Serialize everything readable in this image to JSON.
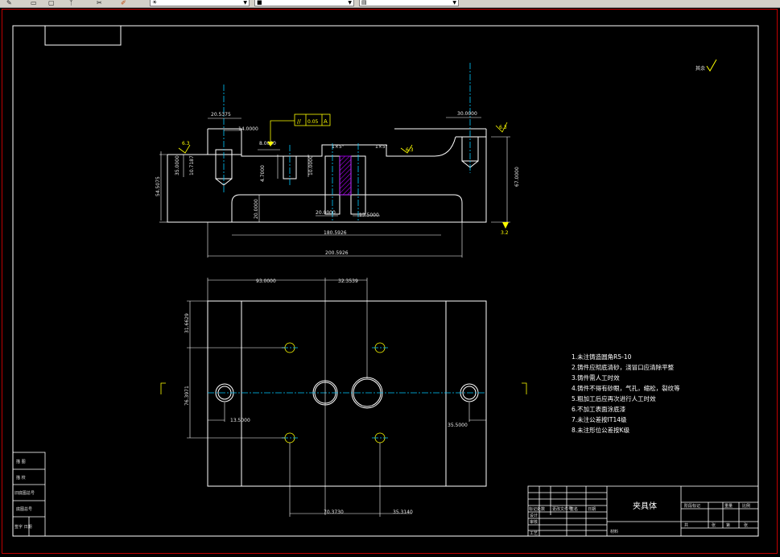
{
  "app": {
    "toolbar": {
      "combo_layer": "",
      "combo_color": "",
      "combo_linetype": ""
    }
  },
  "colors": {
    "background": "#000000",
    "line": "#ffffff",
    "centerline": "#00c8ff",
    "dimension": "#ffffff",
    "hatch": "#b000ff",
    "datum": "#ffff00",
    "frame": "#c00000"
  },
  "drawing": {
    "roughness_note": "其余",
    "top_view": {
      "dims": {
        "d1": "20.5375",
        "d2": "14.0000",
        "d3": "30.0000",
        "d4": "8.0000",
        "d5": "20.0000",
        "d6": "13.5000",
        "d7": "180.5926",
        "d8": "200.5926",
        "d9": "54.5075",
        "d10": "35.0000",
        "d11": "10.7187",
        "d12": "67.0000",
        "d13": "20.0000",
        "d14": "4.7000",
        "d15": "10.0000"
      },
      "tolerance_symbol": "//",
      "tolerance_value": "0.05",
      "datum_a": "A",
      "datum_b": "B",
      "section_labels": [
        "1×5°",
        "1×5°"
      ],
      "roughness_labels": [
        "6.3",
        "6.3",
        "6.3",
        "3.2"
      ]
    },
    "front_view": {
      "dims": {
        "d1": "93.0000",
        "d2": "32.3539",
        "d3": "31.6629",
        "d4": "76.3971",
        "d5": "13.5000",
        "d6": "35.5000",
        "d7": "70.3730",
        "d8": "35.3140"
      },
      "section_mark": "L"
    },
    "notes": [
      "1.未注铸造圆角R5-10",
      "2.铸件应彻底清砂，浇冒口应清除平整",
      "3.铸件需人工时效",
      "4.铸件不得有砂眼，气孔，缩松，裂纹等",
      "5.粗加工后应再次进行人工时效",
      "6.不加工表面涂底漆",
      "7.未注公差按IT14级",
      "8.未注形位公差按K级"
    ]
  },
  "title_block": {
    "part_name": "夹具体",
    "material_label": "材料",
    "side_rows": [
      "描 图",
      "描 校",
      "旧底图总号",
      "底图总号",
      "签字 日期"
    ],
    "rows": [
      "标记处数",
      "更改文件号",
      "签名",
      "日期",
      "设计",
      "审核",
      "工艺"
    ],
    "right_header": [
      "阶段标记",
      "重量",
      "比例"
    ],
    "right_footer": [
      "共",
      "张",
      "第",
      "张"
    ]
  }
}
